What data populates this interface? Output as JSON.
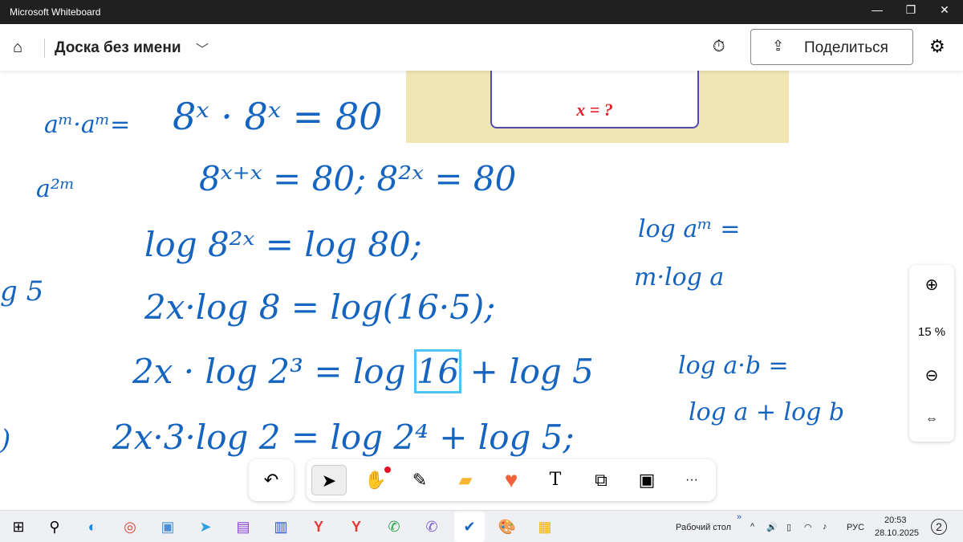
{
  "window": {
    "title": "Microsoft Whiteboard",
    "min": "—",
    "max": "❐",
    "close": "✕"
  },
  "header": {
    "home_icon": "⌂",
    "board_title": "Доска без имени",
    "chevron": "﹀",
    "timer_icon": "⏱",
    "share_icon": "⇪",
    "share_label": "Поделиться",
    "settings_icon": "⚙"
  },
  "image": {
    "question": "x = ?"
  },
  "ink": {
    "l1a": "aᵐ·aᵐ=",
    "l1b": "a²ᵐ",
    "left_frag": "g 5",
    "left_frag2": ")",
    "eq1": "8ˣ · 8ˣ = 80",
    "eq2": "8ˣ⁺ˣ = 80;   8²ˣ = 80",
    "eq3": "log 8²ˣ = log 80;",
    "eq4": "2x·log 8 = log(16·5);",
    "eq5a": "2x · log 2³ = log ",
    "eq5b": "16",
    "eq5c": " + log 5",
    "eq6": "2x·3·log 2 = log 2⁴ + log 5;",
    "r1a": "log aᵐ =",
    "r1b": "m·log a",
    "r2a": "log a·b =",
    "r2b": "log a + log b"
  },
  "zoom": {
    "in_icon": "⊕",
    "level": "15 %",
    "out_icon": "⊖",
    "fit_icon": "⇔"
  },
  "toolbar": {
    "undo": "↶",
    "select": "➤",
    "hand": "✋",
    "pen": "✎",
    "note": "▰",
    "heart": "♥",
    "text": "T",
    "shapes": "⧉",
    "template": "▣",
    "more": "···",
    "accent": "#e81123"
  },
  "taskbar": {
    "icons": [
      "⊞",
      "⚲",
      "◐",
      "◎",
      "▣",
      "➤",
      "▤",
      "▥",
      "Y",
      "Y",
      "✆",
      "✆",
      "✔",
      "🎨",
      "▦"
    ],
    "desktop": "Рабочий стол",
    "chevron": "»",
    "tray_up": "^",
    "tray_icons": [
      "🔊",
      "▯",
      "◠",
      "♪"
    ],
    "lang": "РУС",
    "time": "20:53",
    "date": "28.10.2025",
    "notif": "2"
  }
}
